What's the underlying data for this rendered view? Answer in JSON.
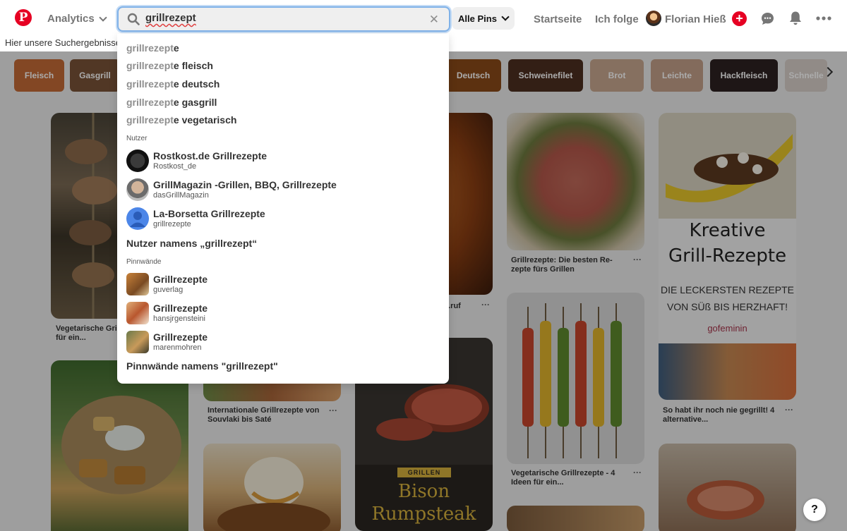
{
  "header": {
    "logo_letter": "P",
    "analytics_label": "Analytics",
    "search_value": "grillrezept",
    "all_pins_label": "Alle Pins",
    "nav": [
      "Startseite",
      "Ich folge"
    ],
    "user_name": "Florian Hieß",
    "plus_label": "+",
    "chat_icon": "💬",
    "bell_icon": "🔔",
    "more_icon": "•••"
  },
  "subtext": "Hier unsere Suchergebnisse",
  "chips_left": [
    {
      "label": "Fleisch",
      "color": "#c46b37"
    },
    {
      "label": "Gasgrill",
      "color": "#7a5238"
    }
  ],
  "chips_right": [
    {
      "label": "Deutsch",
      "color": "#8a4a18"
    },
    {
      "label": "Schweinefilet",
      "color": "#4d2f20"
    },
    {
      "label": "Brot",
      "color": "#c8a78f"
    },
    {
      "label": "Leichte",
      "color": "#c4a08a"
    },
    {
      "label": "Hackfleisch",
      "color": "#2d2222"
    },
    {
      "label": "Schnelle",
      "color": "#d8d0ca"
    }
  ],
  "pins": {
    "col1_caption": "Vegetarische Grillrezepte - 4 Ideen für ein...",
    "col2_caption": "Internationale Grillrezepte von Souvlaki bis Saté",
    "col3_caption": "...ruf",
    "col3_grillen_label": "GRILLEN",
    "col3_title_line1": "Bison",
    "col3_title_line2": "Rumpsteak",
    "col4a_caption": "Grillrezepte: Die besten Re- zepte fürs Grillen",
    "col4b_caption": "Vegetarische Grillrezepte - 4 Ideen für ein...",
    "col5_title_line1": "Kreative",
    "col5_title_line2": "Grill-Rezepte",
    "col5_sub_line1": "DIE LECKERSTEN REZEPTE",
    "col5_sub_line2": "VON SÜß BIS HERZHAFT!",
    "col5_brand": "gofeminin",
    "col5_caption": "So habt ihr noch nie gegrillt! 4 alternative...",
    "more": "···"
  },
  "help_label": "?",
  "dropdown": {
    "suggestions": [
      {
        "typed": "grillrezept",
        "rest": "e"
      },
      {
        "typed": "grillrezept",
        "rest": "e fleisch"
      },
      {
        "typed": "grillrezept",
        "rest": "e deutsch"
      },
      {
        "typed": "grillrezept",
        "rest": "e gasgrill"
      },
      {
        "typed": "grillrezept",
        "rest": "e vegetarisch"
      }
    ],
    "users_label": "Nutzer",
    "users": [
      {
        "name": "Rostkost.de Grillrezepte",
        "handle": "Rostkost_de"
      },
      {
        "name": "GrillMagazin -Grillen, BBQ, Grillrezepte",
        "handle": "dasGrillMagazin"
      },
      {
        "name": "La-Borsetta Grillrezepte",
        "handle": "grillrezepte"
      }
    ],
    "users_more": "Nutzer namens „grillrezept“",
    "boards_label": "Pinnwände",
    "boards": [
      {
        "name": "Grillrezepte",
        "owner": "guverlag"
      },
      {
        "name": "Grillrezepte",
        "owner": "hansjrgensteini"
      },
      {
        "name": "Grillrezepte",
        "owner": "marenmohren"
      }
    ],
    "boards_more": "Pinnwände namens \"grillrezept\""
  }
}
